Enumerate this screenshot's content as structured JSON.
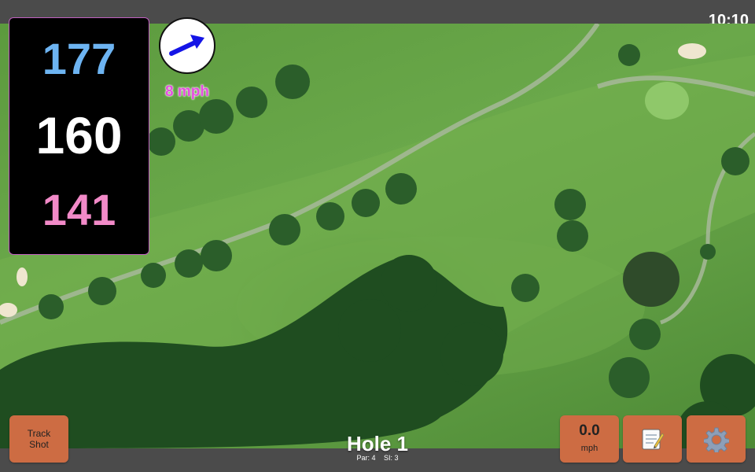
{
  "status": {
    "time": "10:10"
  },
  "distances": {
    "back": "177",
    "middle": "160",
    "front": "141"
  },
  "wind": {
    "speed_label": "8 mph",
    "arrow_icon": "wind-arrow-icon"
  },
  "buttons": {
    "track_shot": "Track\nShot",
    "speed_value": "0.0",
    "speed_unit": "mph",
    "notes_icon": "notepad-icon",
    "settings_icon": "gear-icon"
  },
  "hole": {
    "title": "Hole 1",
    "par": "Par: 4",
    "si": "SI: 3"
  },
  "colors": {
    "back": "#6db4f2",
    "middle": "#ffffff",
    "front": "#f28ac8",
    "wind_speed": "#e64ee0",
    "button": "#cd6c43",
    "bar": "#4b4b4b"
  }
}
